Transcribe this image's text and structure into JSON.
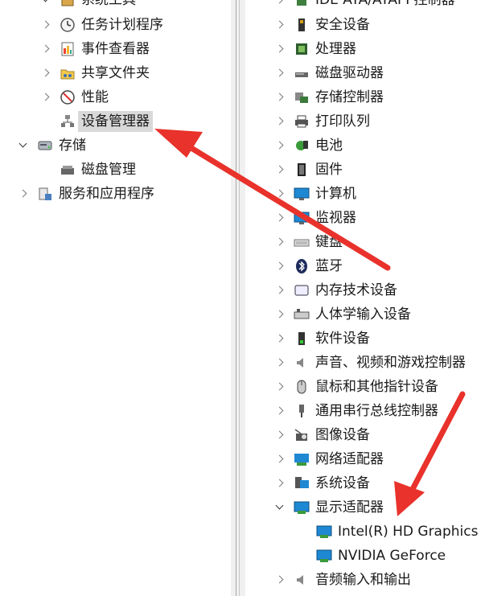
{
  "left_tree": {
    "items": [
      {
        "label": "系统工具",
        "name": "tree-item-system-tools",
        "icon": "toolbox-icon"
      },
      {
        "label": "任务计划程序",
        "name": "tree-item-task-scheduler",
        "icon": "clock-icon"
      },
      {
        "label": "事件查看器",
        "name": "tree-item-event-viewer",
        "icon": "event-log-icon"
      },
      {
        "label": "共享文件夹",
        "name": "tree-item-shared-folders",
        "icon": "shared-folder-icon"
      },
      {
        "label": "性能",
        "name": "tree-item-performance",
        "icon": "performance-gauge-icon"
      },
      {
        "label": "设备管理器",
        "name": "tree-item-device-manager",
        "icon": "device-manager-icon"
      },
      {
        "label": "存储",
        "name": "tree-item-storage",
        "icon": "storage-icon"
      },
      {
        "label": "磁盘管理",
        "name": "tree-item-disk-management",
        "icon": "disk-management-icon"
      },
      {
        "label": "服务和应用程序",
        "name": "tree-item-services-apps",
        "icon": "services-icon"
      }
    ]
  },
  "device_tree": {
    "items": [
      {
        "label": "IDE ATA/ATAPI 控制器",
        "name": "device-category-ide-ata",
        "icon": "ide-controller-icon"
      },
      {
        "label": "安全设备",
        "name": "device-category-security-devices",
        "icon": "security-device-icon"
      },
      {
        "label": "处理器",
        "name": "device-category-processors",
        "icon": "processor-icon"
      },
      {
        "label": "磁盘驱动器",
        "name": "device-category-disk-drives",
        "icon": "disk-drive-icon"
      },
      {
        "label": "存储控制器",
        "name": "device-category-storage-controllers",
        "icon": "storage-controller-icon"
      },
      {
        "label": "打印队列",
        "name": "device-category-print-queues",
        "icon": "printer-icon"
      },
      {
        "label": "电池",
        "name": "device-category-batteries",
        "icon": "battery-icon"
      },
      {
        "label": "固件",
        "name": "device-category-firmware",
        "icon": "firmware-icon"
      },
      {
        "label": "计算机",
        "name": "device-category-computer",
        "icon": "computer-icon"
      },
      {
        "label": "监视器",
        "name": "device-category-monitors",
        "icon": "monitor-icon"
      },
      {
        "label": "键盘",
        "name": "device-category-keyboards",
        "icon": "keyboard-icon"
      },
      {
        "label": "蓝牙",
        "name": "device-category-bluetooth",
        "icon": "bluetooth-icon"
      },
      {
        "label": "内存技术设备",
        "name": "device-category-memory-technology",
        "icon": "memory-device-icon"
      },
      {
        "label": "人体学输入设备",
        "name": "device-category-hid",
        "icon": "hid-icon"
      },
      {
        "label": "软件设备",
        "name": "device-category-software-devices",
        "icon": "software-device-icon"
      },
      {
        "label": "声音、视频和游戏控制器",
        "name": "device-category-sound-video-game",
        "icon": "speaker-icon"
      },
      {
        "label": "鼠标和其他指针设备",
        "name": "device-category-mice",
        "icon": "mouse-icon"
      },
      {
        "label": "通用串行总线控制器",
        "name": "device-category-usb-controllers",
        "icon": "usb-icon"
      },
      {
        "label": "图像设备",
        "name": "device-category-imaging-devices",
        "icon": "camera-icon"
      },
      {
        "label": "网络适配器",
        "name": "device-category-network-adapters",
        "icon": "network-adapter-icon"
      },
      {
        "label": "系统设备",
        "name": "device-category-system-devices",
        "icon": "system-device-icon"
      },
      {
        "label": "显示适配器",
        "name": "device-category-display-adapters",
        "icon": "display-adapter-icon"
      },
      {
        "label": "Intel(R) HD Graphics",
        "name": "device-intel-hd-graphics",
        "icon": "display-adapter-icon"
      },
      {
        "label": "NVIDIA GeForce",
        "name": "device-nvidia-geforce",
        "icon": "display-adapter-icon"
      },
      {
        "label": "音频输入和输出",
        "name": "device-category-audio-io",
        "icon": "audio-io-icon"
      }
    ]
  },
  "colors": {
    "arrow": "#e8322b",
    "selection": "#d9d9d9",
    "monitor_blue": "#1e88d2"
  }
}
